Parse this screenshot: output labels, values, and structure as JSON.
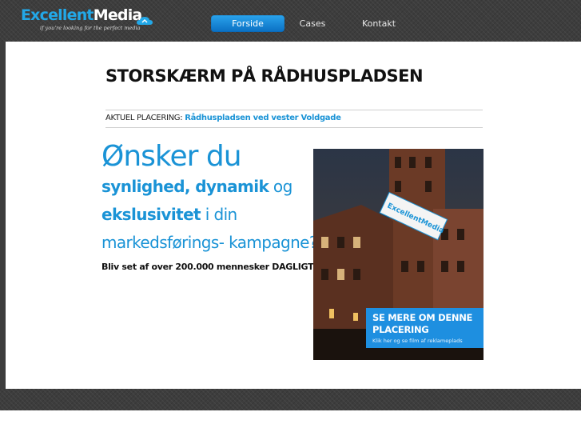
{
  "header": {
    "logo_part1": "Excellent",
    "logo_part2": "Media",
    "tagline": "if you're looking for the perfect media"
  },
  "nav": {
    "items": [
      {
        "label": "Forside",
        "active": true
      },
      {
        "label": "Cases",
        "active": false
      },
      {
        "label": "Kontakt",
        "active": false
      }
    ]
  },
  "main": {
    "title": "STORSKÆRM PÅ RÅDHUSPLADSEN",
    "placement_label": "AKTUEL PLACERING:",
    "placement_value": "Rådhuspladsen ved vester Voldgade",
    "hero_line1": "Ønsker du",
    "hero_line2_bold": "synlighed, dynamik",
    "hero_line2_rest": " og",
    "hero_line3_bold": "ekslusivitet",
    "hero_line3_rest": " i din",
    "hero_line4": "markedsførings- kampagne?",
    "hero_sub": "Bliv set af over 200.000 mennesker DAGLIGT!",
    "billboard_text": "ExcellentMedia",
    "cta_title": "SE MERE OM DENNE PLACERING",
    "cta_sub": "Klik her og se film af reklameplads"
  },
  "colors": {
    "accent": "#1a93d6",
    "nav_active": "#1a8ee0",
    "dark_bg": "#3d3d3d"
  },
  "icons": [
    "cloud-icon"
  ]
}
